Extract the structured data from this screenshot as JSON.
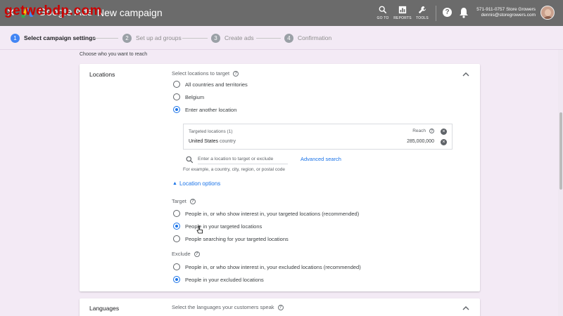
{
  "topbar": {
    "close_icon": "close-icon",
    "app_title": "Google Ads",
    "page_title": "New campaign",
    "tools": [
      {
        "label": "GO TO",
        "icon": "search-icon"
      },
      {
        "label": "REPORTS",
        "icon": "reports-icon"
      },
      {
        "label": "TOOLS",
        "icon": "wrench-icon"
      }
    ],
    "account_line1": "571-911-0757 Store Growers",
    "account_line2": "dennis@storegrowers.com"
  },
  "steps": [
    {
      "num": "1",
      "label": "Select campaign settings",
      "active": true
    },
    {
      "num": "2",
      "label": "Set up ad groups",
      "active": false
    },
    {
      "num": "3",
      "label": "Create ads",
      "active": false
    },
    {
      "num": "4",
      "label": "Confirmation",
      "active": false
    }
  ],
  "reach_heading": "Choose who you want to reach",
  "locations": {
    "title": "Locations",
    "select_label": "Select locations to target",
    "options": [
      {
        "label": "All countries and territories",
        "selected": false
      },
      {
        "label": "Belgium",
        "selected": false
      },
      {
        "label": "Enter another location",
        "selected": true
      }
    ],
    "targeted_header": "Targeted locations (1)",
    "reach_label": "Reach",
    "targeted": {
      "name": "United States",
      "kind": "country",
      "reach": "285,000,000"
    },
    "search_placeholder": "Enter a location to target or exclude",
    "advanced_search": "Advanced search",
    "hint": "For example, a country, city, region, or postal code",
    "location_options": "Location options",
    "target_label": "Target",
    "target_options": [
      {
        "label": "People in, or who show interest in, your targeted locations (recommended)",
        "selected": false
      },
      {
        "label": "People in your targeted locations",
        "selected": true
      },
      {
        "label": "People searching for your targeted locations",
        "selected": false
      }
    ],
    "exclude_label": "Exclude",
    "exclude_options": [
      {
        "label": "People in, or who show interest in, your excluded locations (recommended)",
        "selected": false
      },
      {
        "label": "People in your excluded locations",
        "selected": true
      }
    ]
  },
  "languages": {
    "title": "Languages",
    "select_label": "Select the languages your customers speak"
  },
  "watermark": "getwebdp.com",
  "colors": {
    "accent": "#1a73e8",
    "topbar": "#6b6b6b",
    "background": "#f3eaf5"
  }
}
